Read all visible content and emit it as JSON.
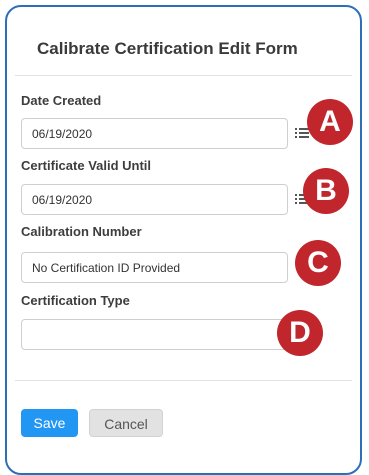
{
  "form": {
    "title": "Calibrate Certification Edit Form",
    "fields": [
      {
        "label": "Date Created",
        "value": "06/19/2020",
        "marker": "A"
      },
      {
        "label": "Certificate Valid Until",
        "value": "06/19/2020",
        "marker": "B"
      },
      {
        "label": "Calibration Number",
        "value": "No Certification ID Provided",
        "marker": "C"
      },
      {
        "label": "Certification Type",
        "value": "",
        "marker": "D"
      }
    ],
    "buttons": {
      "save": "Save",
      "cancel": "Cancel"
    }
  },
  "colors": {
    "accent": "#2196f3",
    "marker": "#c0262c",
    "border": "#2c6fb7"
  }
}
